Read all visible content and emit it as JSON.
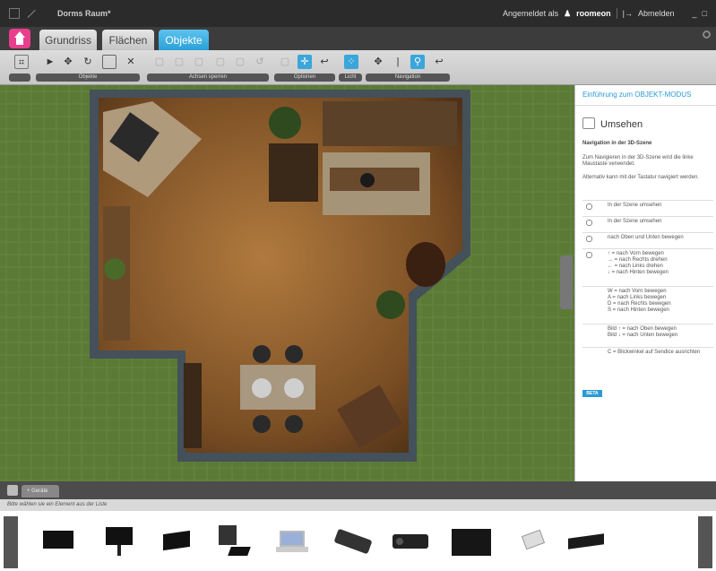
{
  "window": {
    "title": "Dorms Raum*"
  },
  "account": {
    "prefix": "Angemeldet als",
    "user": "roomeon",
    "logout": "Abmelden",
    "minimize": "_",
    "maximize": "□"
  },
  "tabs": [
    {
      "label": "Grundriss",
      "active": false
    },
    {
      "label": "Flächen",
      "active": false
    },
    {
      "label": "Objekte",
      "active": true
    }
  ],
  "toolbar": {
    "groups": [
      "Objekte",
      "Achsen sperren",
      "Optionen",
      "Licht",
      "Navigation"
    ],
    "icons": [
      "camera-icon",
      "cursor-icon",
      "move-icon",
      "rotate-icon",
      "resize-icon",
      "delete-icon",
      "lock-x-icon",
      "lock-y-icon",
      "lock-z-icon",
      "lock-rot-icon",
      "lock-scale-icon",
      "undo-icon",
      "options1-icon",
      "grid-icon",
      "snap-icon",
      "light-icon",
      "pan-icon",
      "height-icon",
      "walk-icon",
      "orbit-icon"
    ]
  },
  "panel": {
    "link": "Einführung zum OBJEKT-MODUS",
    "heading": "Umsehen",
    "subheading": "Navigation in der 3D-Szene",
    "intro1": "Zum Navigieren in der 3D-Szene wird die linke Maustaste verwendet.",
    "intro2": "Alternativ kann mit der Tastatur navigiert werden.",
    "rows": [
      "In der Szene umsehen",
      "In der Szene umsehen",
      "nach Oben und Unten bewegen",
      "↑ = nach Vorn bewegen\n→ = nach Rechts drehen\n← = nach Links drehen\n↓ = nach Hinten bewegen",
      "W = nach Vorn bewegen\nA = nach Links bewegen\nD = nach Rechts bewegen\nS = nach Hinten bewegen",
      "Bild ↑ = nach Oben bewegen\nBild ↓ = nach Unten bewegen",
      "C = Blickwinkel auf Sendice ausrichten"
    ],
    "badge": "BETA"
  },
  "bottom": {
    "tab": "+ Geräte",
    "hint": "Bitte wählen sie ein Element aus der Liste"
  },
  "catalog": {
    "items": [
      "flat-tv",
      "tv-on-stand",
      "monitor",
      "desktop-pc",
      "laptop",
      "game-console",
      "projector",
      "media-cabinet",
      "telephone",
      "dvd-player"
    ]
  },
  "colors": {
    "accent": "#29a0d8",
    "home": "#e83e8c",
    "grass": "#5d7a38",
    "floor": "#8a5a2c"
  }
}
